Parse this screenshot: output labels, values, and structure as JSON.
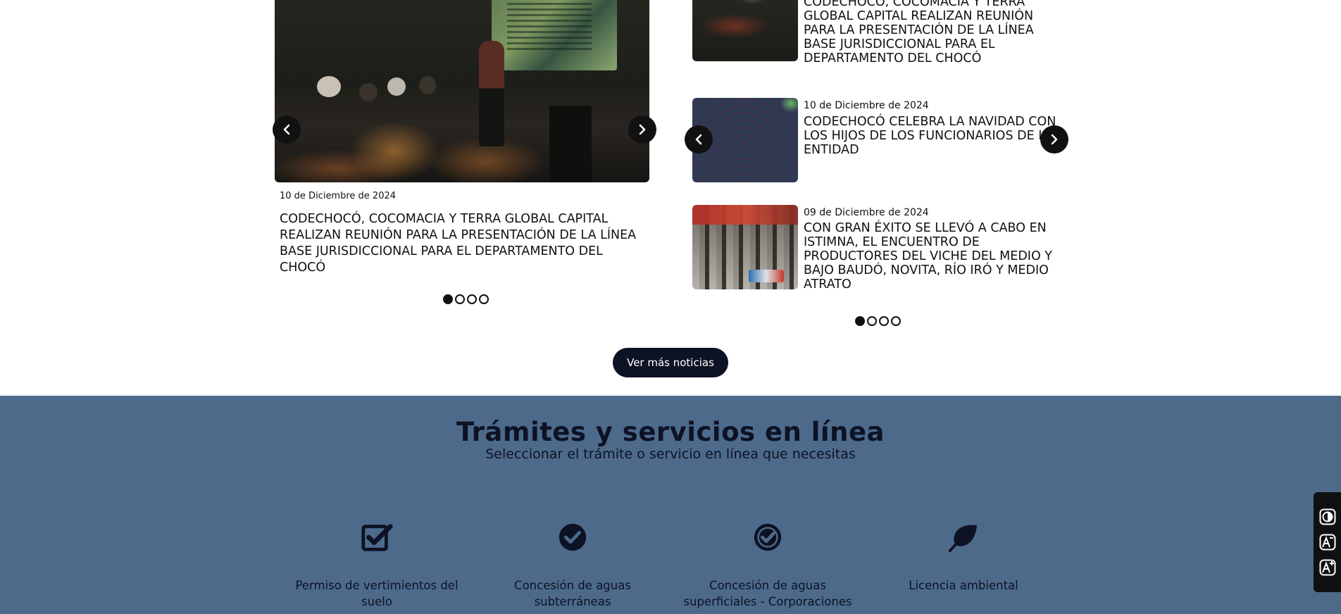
{
  "featured": {
    "date": "10 de Diciembre de 2024",
    "title": "CODECHOCÓ, COCOMACIA Y TERRA GLOBAL CAPITAL REALIZAN REUNIÓN PARA LA PRESENTACIÓN DE LA LÍNEA BASE JURISDICCIONAL PARA EL DEPARTAMENTO DEL CHOCÓ"
  },
  "news_list": [
    {
      "date": "",
      "title": "CODECHOCÓ, COCOMACIA Y TERRA GLOBAL CAPITAL REALIZAN REUNIÓN PARA LA PRESENTACIÓN DE LA LÍNEA BASE JURISDICCIONAL PARA EL DEPARTAMENTO DEL CHOCÓ"
    },
    {
      "date": "10 de Diciembre de 2024",
      "title": "CODECHOCÓ CELEBRA LA NAVIDAD CON LOS HIJOS DE LOS FUNCIONARIOS DE LA ENTIDAD"
    },
    {
      "date": "09 de Diciembre de 2024",
      "title": "CON GRAN ÉXITO SE LLEVÓ A CABO EN ISTIMNA, EL ENCUENTRO DE PRODUCTORES DEL VICHE DEL MEDIO Y BAJO BAUDÓ, NOVITA, RÍO IRÓ Y MEDIO ATRATO"
    }
  ],
  "more_button": {
    "label": "Ver más noticias"
  },
  "services": {
    "title": "Trámites y servicios en línea",
    "subtitle": "Seleccionar el trámite o servicio en línea que necesitas",
    "items": [
      {
        "label": "Permiso de vertimientos del suelo",
        "icon": "check-square-icon"
      },
      {
        "label": "Concesión de aguas subterráneas",
        "icon": "check-circle-icon"
      },
      {
        "label": "Concesión de aguas superficiales - Corporaciones",
        "icon": "check-circle-icon"
      },
      {
        "label": "Licencia ambiental",
        "icon": "leaf-icon"
      }
    ]
  },
  "accessibility": {
    "items": [
      "contrast-icon",
      "decrease-font-icon",
      "increase-font-icon"
    ]
  },
  "colors": {
    "services_bg": "#4d6a8b",
    "dark": "#0d1224",
    "button_bg": "#0d1224"
  }
}
